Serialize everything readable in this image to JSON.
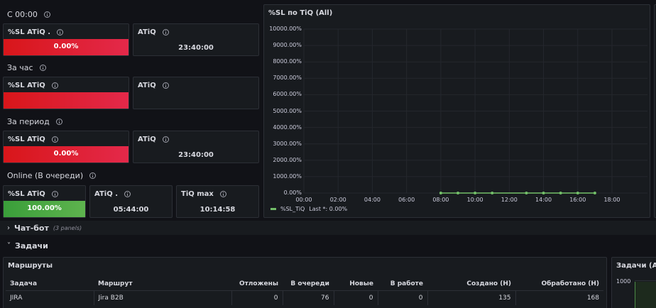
{
  "groups": [
    {
      "title": "С 00:00",
      "sl_title": "%SL ATiQ .",
      "sl_value": "0.00%",
      "atiq_title": "ATiQ",
      "atiq_value": "23:40:00"
    },
    {
      "title": "За час",
      "sl_title": "%SL ATiQ",
      "sl_value": "",
      "atiq_title": "ATiQ",
      "atiq_value": ""
    },
    {
      "title": "За период",
      "sl_title": "%SL ATiQ",
      "sl_value": "0.00%",
      "atiq_title": "ATiQ",
      "atiq_value": "23:40:00"
    }
  ],
  "online": {
    "title": "Online (В очереди)",
    "sl_title": "%SL ATiQ",
    "sl_value": "100.00%",
    "sl_fill": 1.0,
    "atiq_title": "ATiQ .",
    "atiq_value": "05:44:00",
    "tiqmax_title": "TiQ max",
    "tiqmax_value": "10:14:58"
  },
  "colors": {
    "red": "#e02f44",
    "green": "#56a64b",
    "line": "#73bf69"
  },
  "chart_panel_title": "%SL по TiQ (All)",
  "chart_data": {
    "type": "line",
    "title": "%SL по TiQ (All)",
    "ylim": [
      0,
      10000
    ],
    "yticks": [
      "0.00%",
      "1000.00%",
      "2000.00%",
      "3000.00%",
      "4000.00%",
      "5000.00%",
      "6000.00%",
      "7000.00%",
      "8000.00%",
      "9000.00%",
      "10000.00%"
    ],
    "xticks": [
      "00:00",
      "02:00",
      "04:00",
      "06:00",
      "08:00",
      "10:00",
      "12:00",
      "14:00",
      "16:00",
      "18:00"
    ],
    "xlim_hours": [
      0,
      18
    ],
    "grid": true,
    "series": [
      {
        "name": "%SL_TiQ",
        "legend_stat": "Last *: 0.00%",
        "x": [
          8,
          9,
          10,
          11,
          13,
          14,
          15,
          16,
          17
        ],
        "y": [
          0,
          0,
          0,
          0,
          0,
          0,
          0,
          0,
          0
        ]
      }
    ]
  },
  "rows": [
    {
      "title": "Чат-бот",
      "note": "(3 panels)",
      "expanded": false
    },
    {
      "title": "Задачи",
      "note": "",
      "expanded": true
    }
  ],
  "routes_panel": {
    "title": "Маршруты",
    "columns": [
      "Задача",
      "Маршрут",
      "Отложены",
      "В очереди",
      "Новые",
      "В работе",
      "Создано (Н)",
      "Обработано (Н)"
    ],
    "rows": [
      [
        "JIRA",
        "Jira B2B",
        "0",
        "76",
        "0",
        "0",
        "135",
        "168"
      ]
    ]
  },
  "tasks_panel": {
    "title": "Задачи (All)",
    "ytick": "1000"
  }
}
